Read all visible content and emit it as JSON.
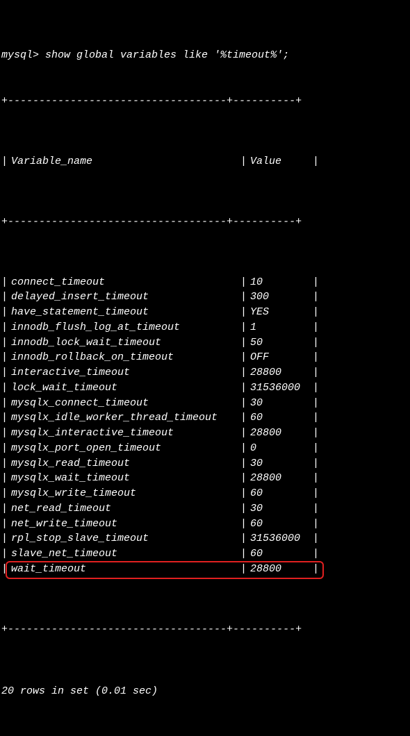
{
  "prompt": "mysql> show global variables like '%timeout%';",
  "sep_top": "+-----------------------------------+----------+",
  "sep_mid": "+-----------------------------------+----------+",
  "sep_bottom": "+-----------------------------------+----------+",
  "header": {
    "name": "Variable_name",
    "value": "Value"
  },
  "rows": [
    {
      "name": "connect_timeout",
      "value": "10"
    },
    {
      "name": "delayed_insert_timeout",
      "value": "300"
    },
    {
      "name": "have_statement_timeout",
      "value": "YES"
    },
    {
      "name": "innodb_flush_log_at_timeout",
      "value": "1"
    },
    {
      "name": "innodb_lock_wait_timeout",
      "value": "50"
    },
    {
      "name": "innodb_rollback_on_timeout",
      "value": "OFF"
    },
    {
      "name": "interactive_timeout",
      "value": "28800"
    },
    {
      "name": "lock_wait_timeout",
      "value": "31536000"
    },
    {
      "name": "mysqlx_connect_timeout",
      "value": "30"
    },
    {
      "name": "mysqlx_idle_worker_thread_timeout",
      "value": "60"
    },
    {
      "name": "mysqlx_interactive_timeout",
      "value": "28800"
    },
    {
      "name": "mysqlx_port_open_timeout",
      "value": "0"
    },
    {
      "name": "mysqlx_read_timeout",
      "value": "30"
    },
    {
      "name": "mysqlx_wait_timeout",
      "value": "28800"
    },
    {
      "name": "mysqlx_write_timeout",
      "value": "60"
    },
    {
      "name": "net_read_timeout",
      "value": "30"
    },
    {
      "name": "net_write_timeout",
      "value": "60"
    },
    {
      "name": "rpl_stop_slave_timeout",
      "value": "31536000"
    },
    {
      "name": "slave_net_timeout",
      "value": "60"
    },
    {
      "name": "wait_timeout",
      "value": "28800"
    }
  ],
  "highlight_index": 19,
  "footer": "20 rows in set (0.01 sec)",
  "pipe": "|"
}
